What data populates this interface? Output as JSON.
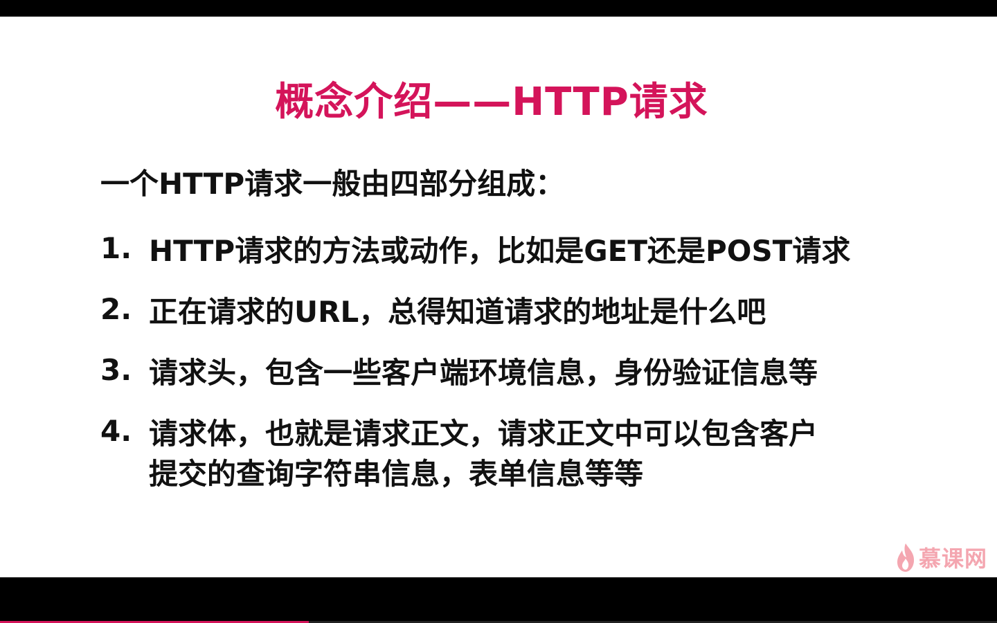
{
  "slide": {
    "title": "概念介绍——HTTP请求",
    "subtitle": "一个HTTP请求一般由四部分组成：",
    "items": [
      {
        "num": "1.",
        "text": "HTTP请求的方法或动作，比如是GET还是POST请求"
      },
      {
        "num": "2.",
        "text": "正在请求的URL，总得知道请求的地址是什么吧"
      },
      {
        "num": "3.",
        "text": "请求头，包含一些客户端环境信息，身份验证信息等"
      },
      {
        "num": "4.",
        "text": "请求体，也就是请求正文，请求正文中可以包含客户\n提交的查询字符串信息，表单信息等等"
      }
    ]
  },
  "logo": {
    "text": "慕课网",
    "icon": "flame-icon"
  },
  "player": {
    "progress": 0.31
  },
  "colors": {
    "title": "#d4145a",
    "body": "#111111",
    "logo": "#f4a6b0"
  }
}
